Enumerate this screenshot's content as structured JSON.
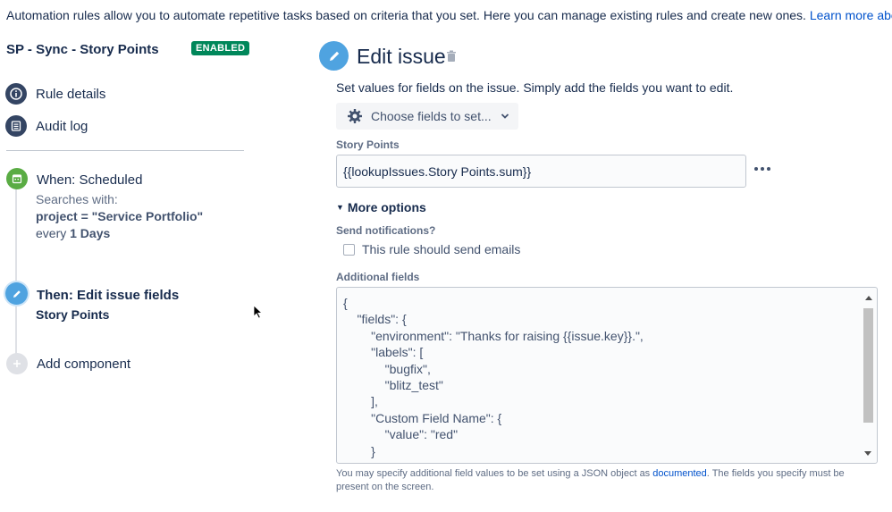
{
  "intro": {
    "text": "Automation rules allow you to automate repetitive tasks based on criteria that you set. Here you can manage existing rules and create new ones. ",
    "link": "Learn more about automation"
  },
  "rule": {
    "title": "SP - Sync - Story Points",
    "status": "ENABLED"
  },
  "nav": {
    "rule_details": "Rule details",
    "audit_log": "Audit log"
  },
  "steps": {
    "when": {
      "title": "When: Scheduled",
      "searches_label": "Searches with:",
      "query": "project = \"Service Portfolio\"",
      "every_label": "every",
      "every_value": "1 Days"
    },
    "then": {
      "title": "Then: Edit issue fields",
      "field": "Story Points"
    },
    "add": "Add component"
  },
  "editor": {
    "title": "Edit issue",
    "description": "Set values for fields on the issue. Simply add the fields you want to edit.",
    "choose_button": "Choose fields to set...",
    "story_points_label": "Story Points",
    "story_points_value": "{{lookupIssues.Story Points.sum}}",
    "more_options": "More options",
    "send_notifications_label": "Send notifications?",
    "send_emails_label": "This rule should send emails",
    "additional_fields_label": "Additional fields",
    "json_lines": [
      "{",
      "    \"fields\": {",
      "        \"environment\": \"Thanks for raising {{issue.key}}.\",",
      "        \"labels\": [",
      "            \"bugfix\",",
      "            \"blitz_test\"",
      "        ],",
      "        \"Custom Field Name\": {",
      "            \"value\": \"red\"",
      "        }"
    ],
    "help_pre": "You may specify additional field values to be set using a JSON object as ",
    "help_link": "documented",
    "help_post": ". The fields you specify must be present on the screen."
  },
  "colors": {
    "enabled_badge": "#00875a",
    "trigger_icon": "#5aac44",
    "action_icon": "#4fa3e0",
    "link": "#0052cc"
  }
}
